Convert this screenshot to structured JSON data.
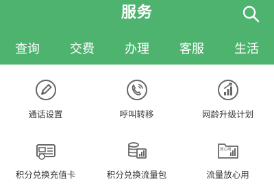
{
  "header": {
    "title": "服务",
    "tabs": [
      "查询",
      "交费",
      "办理",
      "客服",
      "生活"
    ],
    "active_tab": "办理"
  },
  "services": [
    {
      "label": "通话设置",
      "icon": "pen-icon"
    },
    {
      "label": "呼叫转移",
      "icon": "phone-icon"
    },
    {
      "label": "网龄升级计划",
      "icon": "bar-growth-icon"
    },
    {
      "label": "积分兑换充值卡",
      "icon": "card-icon"
    },
    {
      "label": "积分兑换流量包",
      "icon": "coins-chart-icon"
    },
    {
      "label": "流量放心用",
      "icon": "folder-icon"
    }
  ],
  "icon_labels": {
    "folder": "放心用"
  },
  "colors": {
    "brand": "#4eb36f",
    "icon": "#666666"
  }
}
